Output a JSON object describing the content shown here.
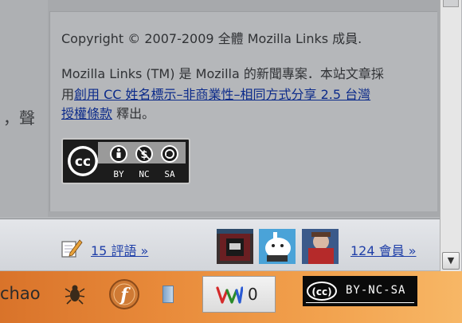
{
  "left_fragment": "，聲",
  "footer": {
    "copyright": "Copyright © 2007-2009 全體 Mozilla Links 成員.",
    "desc_line1": "Mozilla Links (TM) 是 Mozilla 的新聞專案．本站文章採",
    "desc_prefix": "用",
    "license_link_line1": "創用 CC 姓名標示–非商業性–相同方式分享 2.5 台灣",
    "license_link_line2": "授權條款",
    "desc_suffix": " 釋出。",
    "badge": {
      "cc": "cc",
      "by": "BY",
      "nc": "NC",
      "sa": "SA"
    }
  },
  "info_bar": {
    "comments_link": "15 評語 »",
    "members_link": "124 會員 »"
  },
  "status_bar": {
    "user_name": "chao",
    "counter_value": "0",
    "cc_status_label": "BY-NC-SA"
  },
  "colors": {
    "link": "#1f3fa8",
    "status_bar_start": "#d9732a",
    "status_bar_end": "#f7b766"
  },
  "icons": [
    "pencil-note-icon",
    "bug-icon",
    "f-icon",
    "book-icon",
    "w-counter-icon",
    "cc-icon",
    "chevron-down-icon"
  ]
}
